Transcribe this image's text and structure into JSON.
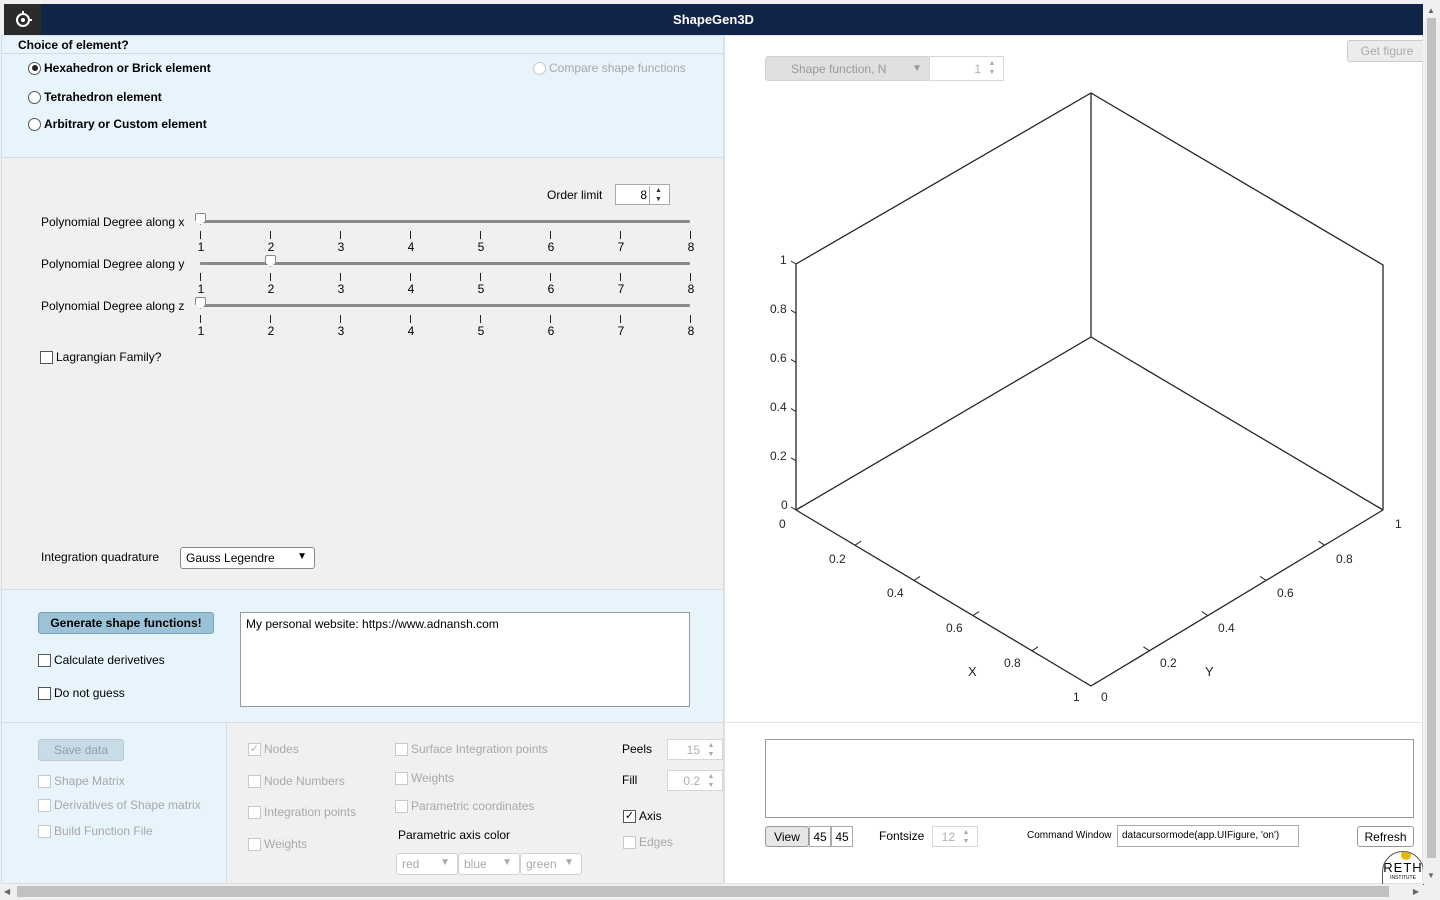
{
  "app": {
    "title": "ShapeGen3D",
    "logo_icon": "gear-icon"
  },
  "element_choice": {
    "heading": "Choice of element?",
    "options": [
      {
        "label": "Hexahedron or Brick element",
        "selected": true
      },
      {
        "label": "Tetrahedron element",
        "selected": false
      },
      {
        "label": "Arbitrary or Custom element",
        "selected": false
      }
    ],
    "compare_label": "Compare shape functions"
  },
  "degrees": {
    "order_limit_label": "Order limit",
    "order_limit_value": "8",
    "sliders": [
      {
        "label": "Polynomial Degree along x",
        "value": 1
      },
      {
        "label": "Polynomial Degree along y",
        "value": 2
      },
      {
        "label": "Polynomial Degree along z",
        "value": 1
      }
    ],
    "tick_labels": [
      "1",
      "2",
      "3",
      "4",
      "5",
      "6",
      "7",
      "8"
    ],
    "lagrangian_label": "Lagrangian Family?",
    "quadrature_label": "Integration quadrature",
    "quadrature_value": "Gauss Legendre"
  },
  "generate": {
    "button_label": "Generate shape functions!",
    "calc_derivatives_label": "Calculate derivetives",
    "do_not_guess_label": "Do not guess",
    "message": "My personal website: https://www.adnansh.com"
  },
  "plot": {
    "get_figure_label": "Get figure",
    "shape_function_label": "Shape function, N",
    "shape_function_index": "1",
    "z_ticks": [
      "0",
      "0.2",
      "0.4",
      "0.6",
      "0.8",
      "1"
    ],
    "x_ticks": [
      "0",
      "0.2",
      "0.4",
      "0.6",
      "0.8",
      "1"
    ],
    "y_ticks": [
      "0",
      "0.2",
      "0.4",
      "0.6",
      "0.8",
      "1"
    ],
    "x_label": "X",
    "y_label": "Y"
  },
  "save": {
    "save_label": "Save data",
    "items": [
      "Shape Matrix",
      "Derivatives of Shape matrix",
      "Build Function File"
    ]
  },
  "display": {
    "col1": [
      {
        "label": "Nodes",
        "checked": true
      },
      {
        "label": "Node Numbers",
        "checked": false
      },
      {
        "label": "Integration points",
        "checked": false
      },
      {
        "label": "Weights",
        "checked": false
      }
    ],
    "col2": [
      {
        "label": "Surface Integration points",
        "checked": false
      },
      {
        "label": "Weights",
        "checked": false
      },
      {
        "label": "Parametric coordinates",
        "checked": false
      }
    ],
    "param_axis_color_label": "Parametric axis color",
    "axis_colors": [
      "red",
      "blue",
      "green"
    ],
    "peels_label": "Peels",
    "peels_value": "15",
    "fill_label": "Fill",
    "fill_value": "0.2",
    "axis_label": "Axis",
    "axis_checked": true,
    "edges_label": "Edges",
    "edges_checked": false
  },
  "command": {
    "view_label": "View",
    "view_az": "45",
    "view_el": "45",
    "fontsize_label": "Fontsize",
    "fontsize_value": "12",
    "cmd_label": "Command Window",
    "cmd_value": "datacursormode(app.UIFigure, 'on')",
    "refresh_label": "Refresh",
    "institute_text": "RETH",
    "institute_sub": "INSTITUTE"
  }
}
